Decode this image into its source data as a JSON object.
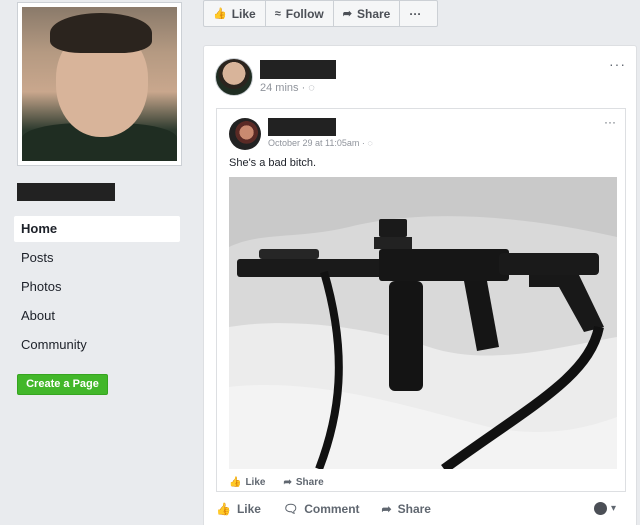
{
  "sidebar": {
    "nav_items": [
      "Home",
      "Posts",
      "Photos",
      "About",
      "Community"
    ],
    "active_item": "Home",
    "create_page_label": "Create a Page"
  },
  "action_bar": {
    "like_label": "Like",
    "follow_label": "Follow",
    "share_label": "Share",
    "more_label": "···",
    "like_icon": "thumbs-up-icon",
    "follow_icon": "rss-icon",
    "share_icon": "share-arrow-icon"
  },
  "post": {
    "time": "24 mins · ◌",
    "menu_label": "···",
    "shared": {
      "time": "October 29 at 11:05am · ◌",
      "menu_label": "···",
      "text": "She's a bad bitch.",
      "like_label": "Like",
      "share_label": "Share"
    },
    "actions": {
      "like_label": "Like",
      "comment_label": "Comment",
      "share_label": "Share"
    },
    "audience_caret": "▾"
  },
  "colors": {
    "page_bg": "#e9ebee",
    "accent_green": "#42b72a",
    "secondary_text": "#90949c"
  }
}
